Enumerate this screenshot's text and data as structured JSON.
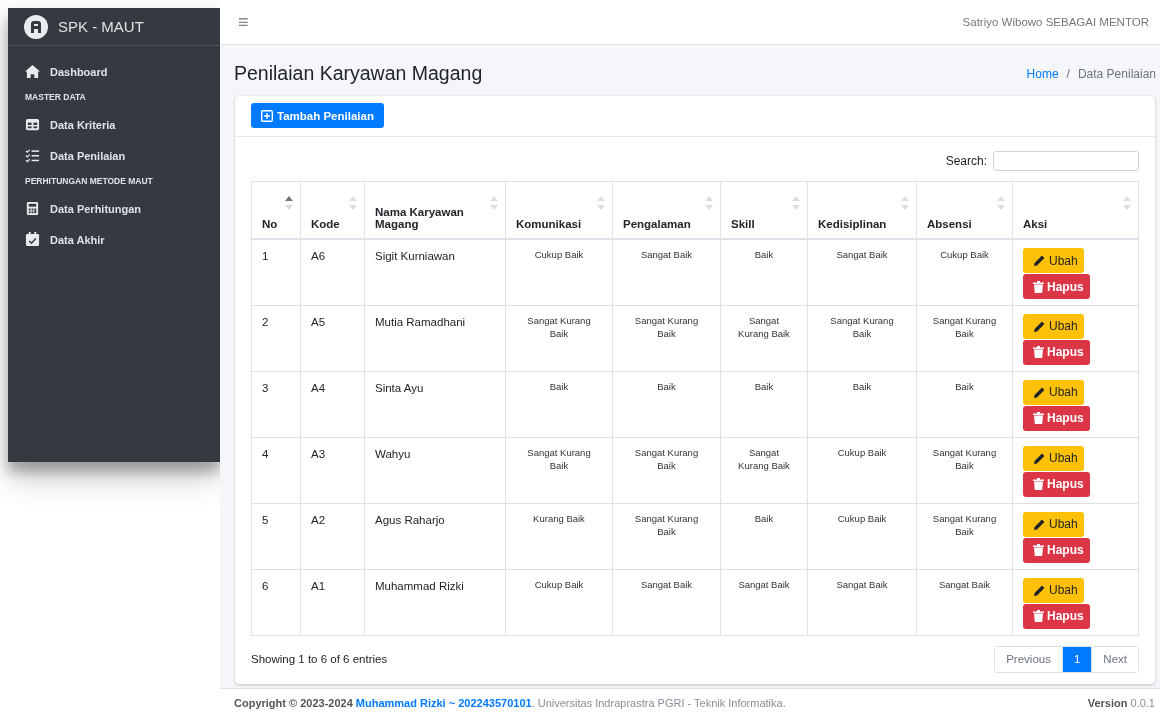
{
  "sidebar": {
    "brand": "SPK - MAUT",
    "sections": [
      {
        "items": [
          {
            "label": "Dashboard",
            "selected": false
          }
        ]
      },
      {
        "heading": "MASTER DATA",
        "items": [
          {
            "label": "Data Kriteria",
            "selected": false
          },
          {
            "label": "Data Penilaian",
            "selected": false
          }
        ]
      },
      {
        "heading": "PERHITUNGAN METODE MAUT",
        "items": [
          {
            "label": "Data Perhitungan",
            "selected": false
          },
          {
            "label": "Data Akhir",
            "selected": false
          }
        ]
      }
    ]
  },
  "topbar": {
    "menu_icon": "≡",
    "user": "Satriyo Wibowo SEBAGAI MENTOR"
  },
  "page": {
    "title": "Penilaian Karyawan Magang",
    "breadcrumb": [
      {
        "label": "Home",
        "kind": "link"
      },
      {
        "label": "/",
        "kind": "separator"
      },
      {
        "label": "Data Penilaian",
        "kind": "current"
      }
    ]
  },
  "card": {
    "add_button": "Tambah Penilaian",
    "search_label": "Search:",
    "table": {
      "columns": [
        {
          "label": "No",
          "sorted_ascending": true
        },
        {
          "label": "Kode",
          "sorted_ascending": false
        },
        {
          "label": "Nama Karyawan Magang",
          "sorted_ascending": false
        },
        {
          "label": "Komunikasi",
          "sorted_ascending": false
        },
        {
          "label": "Pengalaman",
          "sorted_ascending": false
        },
        {
          "label": "Skill",
          "sorted_ascending": false
        },
        {
          "label": "Kedisiplinan",
          "sorted_ascending": false
        },
        {
          "label": "Absensi",
          "sorted_ascending": false
        },
        {
          "label": "Aksi",
          "sorted_ascending": false
        }
      ],
      "rows": [
        {
          "no": "1",
          "kode": "A6",
          "nama": "Sigit Kurniawan",
          "scores": [
            "Cukup Baik",
            "Sangat Baik",
            "Baik",
            "Sangat Baik",
            "Cukup Baik"
          ],
          "actions": [
            "Ubah",
            "Hapus"
          ]
        },
        {
          "no": "2",
          "kode": "A5",
          "nama": "Mutia Ramadhani",
          "scores": [
            "Sangat Kurang Baik",
            "Sangat Kurang Baik",
            "Sangat Kurang Baik",
            "Sangat Kurang Baik",
            "Sangat Kurang Baik"
          ],
          "actions": [
            "Ubah",
            "Hapus"
          ]
        },
        {
          "no": "3",
          "kode": "A4",
          "nama": "Sinta Ayu",
          "scores": [
            "Baik",
            "Baik",
            "Baik",
            "Baik",
            "Baik"
          ],
          "actions": [
            "Ubah",
            "Hapus"
          ]
        },
        {
          "no": "4",
          "kode": "A3",
          "nama": "Wahyu",
          "scores": [
            "Sangat Kurang Baik",
            "Sangat Kurang Baik",
            "Sangat Kurang Baik",
            "Cukup Baik",
            "Sangat Kurang Baik"
          ],
          "actions": [
            "Ubah",
            "Hapus"
          ]
        },
        {
          "no": "5",
          "kode": "A2",
          "nama": "Agus Raharjo",
          "scores": [
            "Kurang Baik",
            "Sangat Kurang Baik",
            "Baik",
            "Cukup Baik",
            "Sangat Kurang Baik"
          ],
          "actions": [
            "Ubah",
            "Hapus"
          ]
        },
        {
          "no": "6",
          "kode": "A1",
          "nama": "Muhammad Rizki",
          "scores": [
            "Cukup Baik",
            "Sangat Baik",
            "Sangat Baik",
            "Sangat Baik",
            "Sangat Baik"
          ],
          "actions": [
            "Ubah",
            "Hapus"
          ]
        }
      ]
    },
    "info": "Showing 1 to 6 of 6 entries",
    "pagination": [
      {
        "label": "Previous",
        "selected": false
      },
      {
        "label": "1",
        "selected": true
      },
      {
        "label": "Next",
        "selected": false
      }
    ]
  },
  "footer": {
    "copyright_prefix": "Copyright © 2023-2024",
    "author": "Muhammad Rizki ~ 202243570101",
    "copyright_suffix": ". Universitas Indraprastra PGRI - Teknik Informatika.",
    "version_label": "Version",
    "version": "0.0.1"
  }
}
